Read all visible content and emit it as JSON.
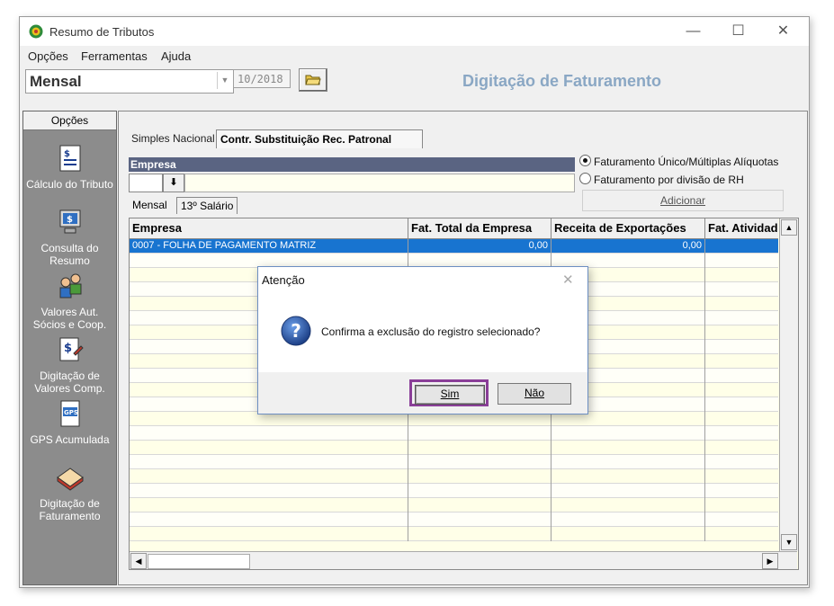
{
  "window": {
    "title": "Resumo de Tributos",
    "minimize": "—",
    "maximize": "☐",
    "close": "✕"
  },
  "menu": {
    "items": [
      "Opções",
      "Ferramentas",
      "Ajuda"
    ]
  },
  "toolbar": {
    "period": "Mensal",
    "month": "10/2018",
    "header_title": "Digitação de Faturamento"
  },
  "sidebar": {
    "title": "Opções",
    "items": [
      {
        "label": "Cálculo do Tributo",
        "icon": "calculator-doc-icon"
      },
      {
        "label": "Consulta do Resumo",
        "icon": "computer-query-icon"
      },
      {
        "label": "Valores Aut. Sócios e  Coop.",
        "icon": "people-money-icon"
      },
      {
        "label": "Digitação de Valores Comp.",
        "icon": "money-doc-edit-icon"
      },
      {
        "label": "GPS Acumulada",
        "icon": "gps-doc-icon"
      },
      {
        "label": "Digitação de Faturamento",
        "icon": "notebook-icon"
      }
    ]
  },
  "tabs": {
    "simples": "Simples Nacional",
    "contr": "Contr. Substituição Rec. Patronal"
  },
  "empresa": {
    "header": "Empresa",
    "lookup": "⬇"
  },
  "options": {
    "radio1": "Faturamento Único/Múltiplas Alíquotas",
    "radio2": "Faturamento por divisão de RH",
    "add": "Adicionar"
  },
  "subtabs": {
    "mensal": "Mensal",
    "decimo": "13º Salário"
  },
  "grid": {
    "columns": [
      "Empresa",
      "Fat. Total da Empresa",
      "Receita de Exportações",
      "Fat. Atividade"
    ],
    "rows": [
      {
        "empresa": "0007 - FOLHA DE PAGAMENTO MATRIZ",
        "fat_total": "0,00",
        "receita_exp": "0,00",
        "fat_ativ": ""
      }
    ]
  },
  "dialog": {
    "title": "Atenção",
    "close": "✕",
    "message": "Confirma a exclusão do registro selecionado?",
    "yes": "Sim",
    "no": "Não"
  }
}
